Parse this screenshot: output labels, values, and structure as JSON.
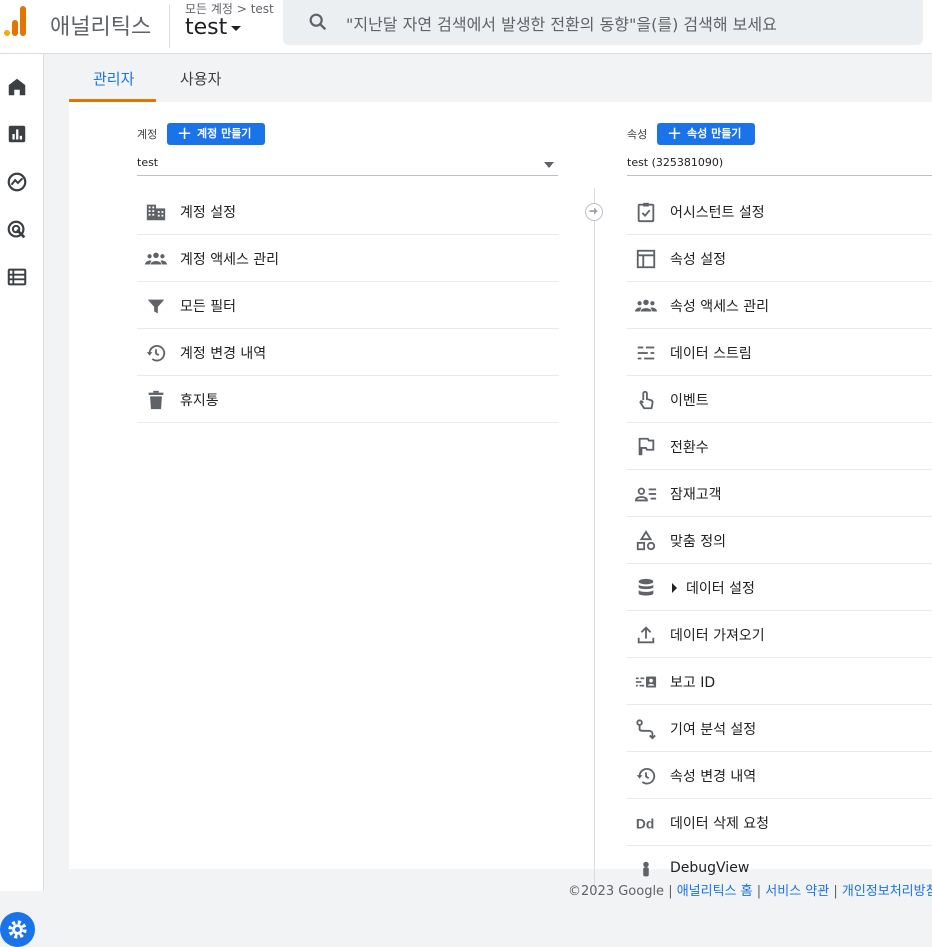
{
  "header": {
    "app_name": "애널리틱스",
    "breadcrumb_all": "모든 계정",
    "breadcrumb_sep": ">",
    "breadcrumb_account": "test",
    "property_name": "test",
    "search_placeholder": "\"지난달 자연 검색에서 발생한 전환의 동향\"을(를) 검색해 보세요"
  },
  "sidenav": {
    "icons": [
      "home-icon",
      "reports-icon",
      "explore-icon",
      "advertising-icon",
      "configure-icon",
      "settings-icon"
    ]
  },
  "tabs": [
    {
      "label": "관리자",
      "active": true
    },
    {
      "label": "사용자",
      "active": false
    }
  ],
  "account_column": {
    "label": "계정",
    "create_button": "계정 만들기",
    "selected": "test",
    "items": [
      {
        "label": "계정 설정",
        "icon": "building-icon"
      },
      {
        "label": "계정 액세스 관리",
        "icon": "people-icon"
      },
      {
        "label": "모든 필터",
        "icon": "filter-icon"
      },
      {
        "label": "계정 변경 내역",
        "icon": "history-icon"
      },
      {
        "label": "휴지통",
        "icon": "trash-icon"
      }
    ]
  },
  "property_column": {
    "label": "속성",
    "create_button": "속성 만들기",
    "selected": "test (325381090)",
    "items": [
      {
        "label": "어시스턴트 설정",
        "icon": "checklist-icon"
      },
      {
        "label": "속성 설정",
        "icon": "layout-icon"
      },
      {
        "label": "속성 액세스 관리",
        "icon": "people-icon"
      },
      {
        "label": "데이터 스트림",
        "icon": "streams-icon"
      },
      {
        "label": "이벤트",
        "icon": "touch-icon"
      },
      {
        "label": "전환수",
        "icon": "flag-icon"
      },
      {
        "label": "잠재고객",
        "icon": "audience-icon"
      },
      {
        "label": "맞춤 정의",
        "icon": "shapes-icon"
      },
      {
        "label": "데이터 설정",
        "icon": "database-icon"
      },
      {
        "label": "데이터 가져오기",
        "icon": "upload-icon"
      },
      {
        "label": "보고 ID",
        "icon": "reporting-id-icon"
      },
      {
        "label": "기여 분석 설정",
        "icon": "attribution-icon"
      },
      {
        "label": "속성 변경 내역",
        "icon": "history-icon"
      },
      {
        "label": "데이터 삭제 요청",
        "icon": "data-deletion-icon"
      },
      {
        "label": "DebugView",
        "icon": "debug-icon"
      }
    ]
  },
  "footer": {
    "copyright": "©2023 Google",
    "link_home": "애널리틱스 홈",
    "link_terms": "서비스 약관",
    "link_privacy": "개인정보처리방침",
    "sep": " | "
  }
}
